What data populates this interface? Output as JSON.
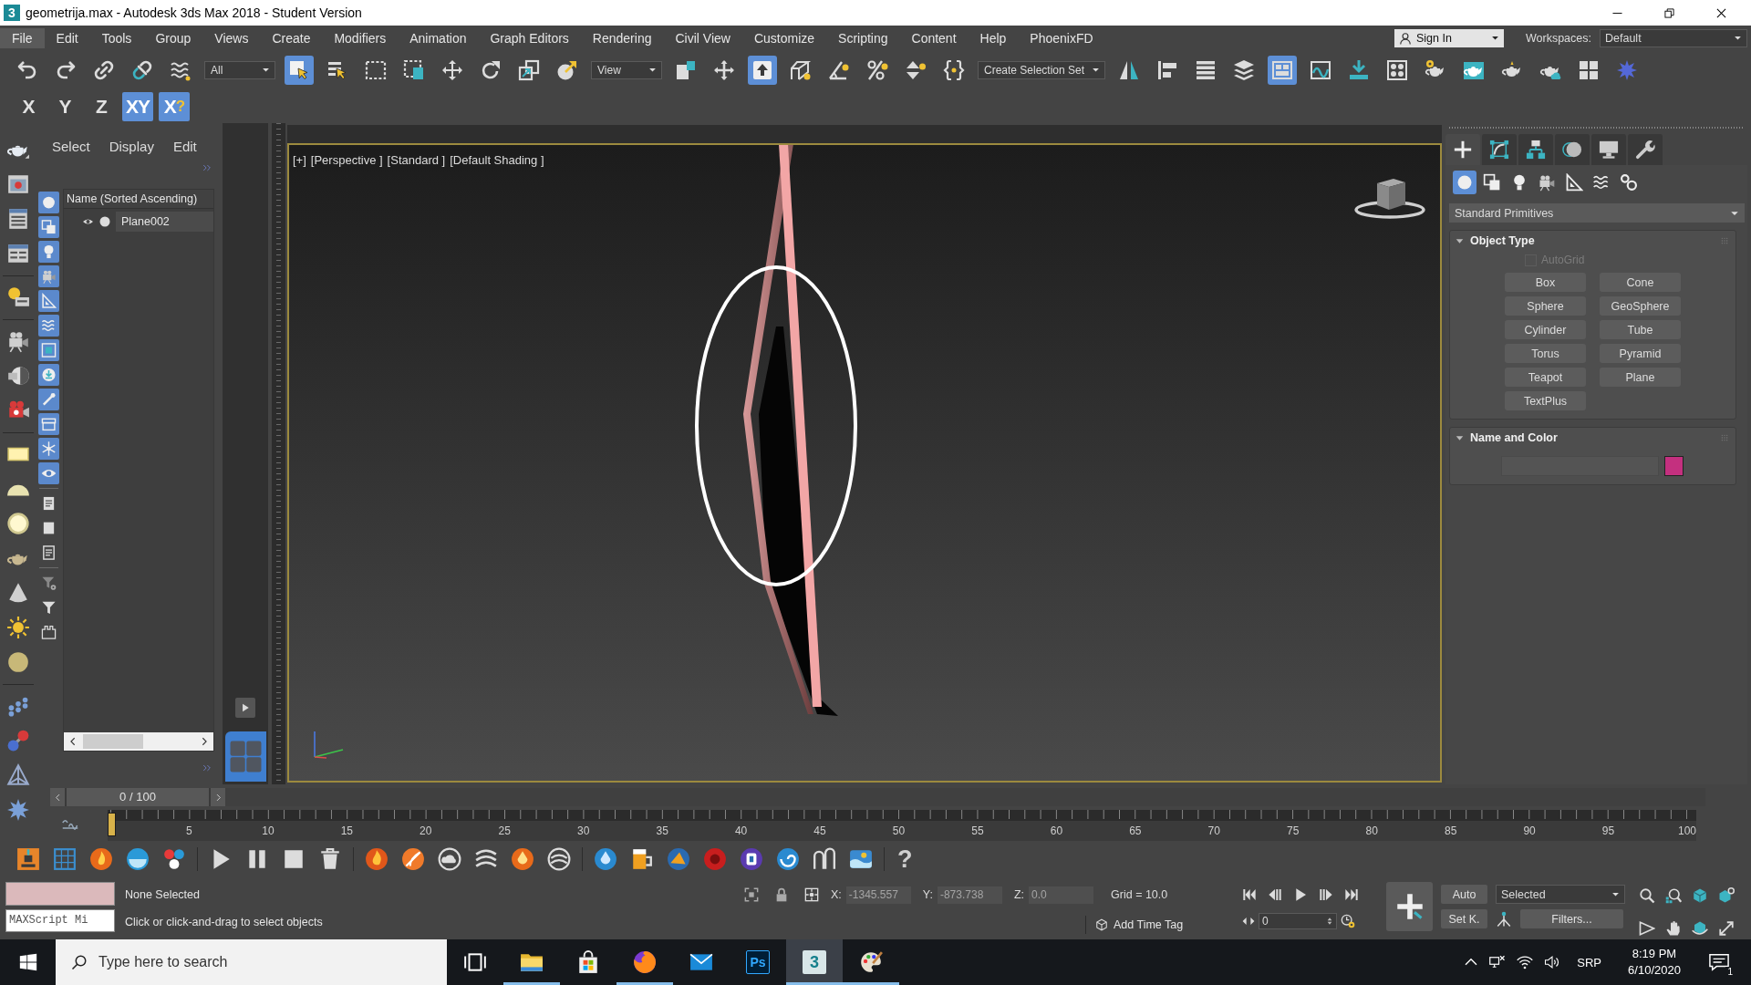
{
  "title_bar": {
    "app_icon": "3",
    "title": "geometrija.max - Autodesk 3ds Max 2018 - Student Version"
  },
  "menu_bar": {
    "items": [
      {
        "label": "File",
        "selected": true
      },
      {
        "label": "Edit",
        "selected": false
      },
      {
        "label": "Tools",
        "selected": false
      },
      {
        "label": "Group",
        "selected": false
      },
      {
        "label": "Views",
        "selected": false
      },
      {
        "label": "Create",
        "selected": false
      },
      {
        "label": "Modifiers",
        "selected": false
      },
      {
        "label": "Animation",
        "selected": false
      },
      {
        "label": "Graph Editors",
        "selected": false
      },
      {
        "label": "Rendering",
        "selected": false
      },
      {
        "label": "Civil View",
        "selected": false
      },
      {
        "label": "Customize",
        "selected": false
      },
      {
        "label": "Scripting",
        "selected": false
      },
      {
        "label": "Content",
        "selected": false
      },
      {
        "label": "Help",
        "selected": false
      },
      {
        "label": "PhoenixFD",
        "selected": false
      }
    ],
    "sign_in": "Sign In",
    "workspaces_label": "Workspaces:",
    "workspace": "Default"
  },
  "main_toolbar": {
    "items": [
      {
        "kind": "undo",
        "selected": false
      },
      {
        "kind": "redo",
        "selected": false
      },
      {
        "kind": "link",
        "selected": false
      },
      {
        "kind": "unlink",
        "selected": false
      },
      {
        "kind": "wave-lines",
        "selected": false
      },
      {
        "kind": "dropdown",
        "value": "All",
        "selected": false
      },
      {
        "kind": "cursor-square",
        "selected": true
      },
      {
        "kind": "list-cursor",
        "selected": false
      },
      {
        "kind": "dashed-rect",
        "selected": false
      },
      {
        "kind": "dashed-rect-square",
        "selected": false
      },
      {
        "kind": "move-arrows",
        "selected": false
      },
      {
        "kind": "rotate-arrow",
        "selected": false
      },
      {
        "kind": "scale-squares",
        "selected": false
      },
      {
        "kind": "sphere-arrow",
        "selected": false
      },
      {
        "kind": "dropdown",
        "value": "View",
        "selected": false
      },
      {
        "kind": "pivot-square",
        "selected": false
      },
      {
        "kind": "crosshair",
        "selected": false
      },
      {
        "kind": "square-arrow",
        "selected": true
      },
      {
        "kind": "cube-snap",
        "selected": false
      },
      {
        "kind": "angle-snap",
        "selected": false
      },
      {
        "kind": "percent-snap",
        "selected": false
      },
      {
        "kind": "spinner-snap",
        "selected": false
      },
      {
        "kind": "braces",
        "selected": false
      },
      {
        "kind": "dropdown",
        "value": "Create Selection Set",
        "selected": false
      },
      {
        "kind": "mirror",
        "selected": false
      },
      {
        "kind": "align",
        "selected": false
      },
      {
        "kind": "list",
        "selected": false
      },
      {
        "kind": "stack",
        "selected": false
      },
      {
        "kind": "ribbon-grid",
        "selected": true
      },
      {
        "kind": "curve-window",
        "selected": false
      },
      {
        "kind": "arrow-down-bar",
        "selected": false
      },
      {
        "kind": "grid-window",
        "selected": false
      },
      {
        "kind": "teapot-gear",
        "selected": false
      },
      {
        "kind": "teapot-window",
        "selected": false
      },
      {
        "kind": "teapot",
        "selected": false
      },
      {
        "kind": "teapot-cloud",
        "selected": false
      },
      {
        "kind": "grid-tiles",
        "selected": false
      },
      {
        "kind": "spiky-ball",
        "selected": false
      }
    ]
  },
  "axis_toolbar": {
    "items": [
      {
        "label": "X",
        "selected": false
      },
      {
        "label": "Y",
        "selected": false
      },
      {
        "label": "Z",
        "selected": false
      },
      {
        "label": "XY",
        "selected": true
      },
      {
        "label": "X",
        "mark": "?",
        "selected": true
      }
    ]
  },
  "scene_explorer": {
    "menu": [
      "Select",
      "Display",
      "Edit"
    ],
    "filter_groups": [
      [
        {
          "kind": "sphere",
          "on": true
        },
        {
          "kind": "shapes",
          "on": true
        },
        {
          "kind": "bulb",
          "on": true
        },
        {
          "kind": "camera",
          "on": true
        },
        {
          "kind": "set-square",
          "on": true
        },
        {
          "kind": "waves",
          "on": true
        },
        {
          "kind": "nested-squares",
          "on": true
        },
        {
          "kind": "download-circle",
          "on": true
        },
        {
          "kind": "stick",
          "on": true
        },
        {
          "kind": "box",
          "on": true
        },
        {
          "kind": "snowflake",
          "on": true
        },
        {
          "kind": "eye",
          "on": true
        }
      ],
      [
        {
          "kind": "document",
          "on": false
        },
        {
          "kind": "square",
          "on": false
        },
        {
          "kind": "document-lines",
          "on": false
        }
      ],
      [
        {
          "kind": "filter-gear",
          "on": false
        },
        {
          "kind": "filter",
          "on": false
        },
        {
          "kind": "bracket-shape",
          "on": false
        }
      ]
    ],
    "column": "Name (Sorted Ascending)",
    "rows": [
      {
        "name": "Plane002"
      }
    ]
  },
  "viewport": {
    "active": true,
    "labels": [
      "[+]",
      "[Perspective ]",
      "[Standard ]",
      "[Default Shading ]"
    ]
  },
  "command_panel": {
    "tabs": [
      {
        "kind": "plus",
        "selected": true
      },
      {
        "kind": "curve-frame",
        "selected": false
      },
      {
        "kind": "hierarchy",
        "selected": false
      },
      {
        "kind": "sphere-rings",
        "selected": false
      },
      {
        "kind": "monitor",
        "selected": false
      },
      {
        "kind": "wrench",
        "selected": false
      }
    ],
    "categories": [
      {
        "kind": "sphere",
        "selected": true
      },
      {
        "kind": "shapes",
        "selected": false
      },
      {
        "kind": "bulb",
        "selected": false
      },
      {
        "kind": "camera",
        "selected": false
      },
      {
        "kind": "set-square",
        "selected": false
      },
      {
        "kind": "waves",
        "selected": false
      },
      {
        "kind": "gears",
        "selected": false
      }
    ],
    "primitive_type": "Standard Primitives",
    "object_type": {
      "title": "Object Type",
      "expanded": true,
      "autogrid": {
        "label": "AutoGrid",
        "checked": false,
        "disabled": true
      },
      "buttons": [
        "Box",
        "Cone",
        "Sphere",
        "GeoSphere",
        "Cylinder",
        "Tube",
        "Torus",
        "Pyramid",
        "Teapot",
        "Plane",
        "TextPlus"
      ]
    },
    "name_and_color": {
      "title": "Name and Color",
      "expanded": true,
      "color": "#c4307f"
    }
  },
  "time_slider": {
    "label": "0 / 100",
    "level": 0
  },
  "track_bar": {
    "labels": [
      "5",
      "10",
      "15",
      "20",
      "25",
      "30",
      "35",
      "40",
      "45",
      "50",
      "55",
      "60",
      "65",
      "70",
      "75",
      "80",
      "85",
      "90",
      "95",
      "100"
    ]
  },
  "bottom_toolbar": {
    "help": "?"
  },
  "status_bar": {
    "listener": "MAXScript Mi",
    "selection": "None Selected",
    "prompt": "Click or click-and-drag to select objects",
    "coordinates": [
      {
        "axis": "X:",
        "value": "-1345.557",
        "disabled": true
      },
      {
        "axis": "Y:",
        "value": "-873.738",
        "disabled": true
      },
      {
        "axis": "Z:",
        "value": "0.0",
        "disabled": true
      }
    ],
    "grid": "Grid = 10.0",
    "time_tag": "Add Time Tag",
    "frame": "0",
    "auto_key": "Auto",
    "key_set": "Selected",
    "set_key": "Set K.",
    "filters": "Filters..."
  },
  "taskbar": {
    "search_placeholder": "Type here to search",
    "apps": [
      {
        "kind": "task-view",
        "running": false,
        "selected": false
      },
      {
        "kind": "folder",
        "running": true,
        "selected": false
      },
      {
        "kind": "shopping-bag",
        "running": false,
        "selected": false
      },
      {
        "kind": "fox-globe",
        "running": true,
        "selected": false
      },
      {
        "kind": "envelope",
        "running": false,
        "selected": false
      },
      {
        "kind": "dark-tile",
        "label": "Ps",
        "running": false,
        "selected": false
      },
      {
        "kind": "teal-tile",
        "label": "3",
        "running": true,
        "selected": true
      },
      {
        "kind": "palette",
        "running": true,
        "selected": false
      }
    ],
    "language": "SRP",
    "time": "8:19 PM",
    "date": "6/10/2020",
    "notifications": "1"
  }
}
